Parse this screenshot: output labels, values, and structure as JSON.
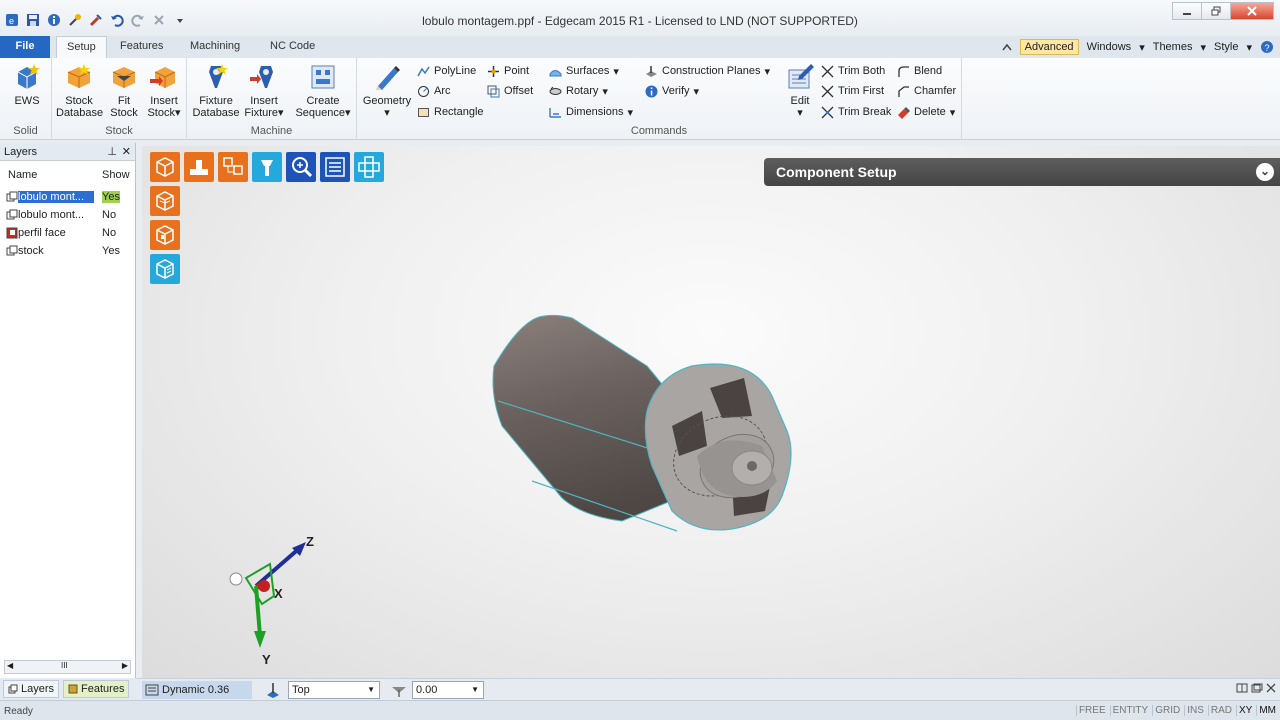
{
  "window": {
    "title": "lobulo montagem.ppf - Edgecam 2015 R1  -  Licensed to LND (NOT SUPPORTED)"
  },
  "tabs": {
    "file": "File",
    "items": [
      "Setup",
      "Features",
      "Machining",
      "NC Code"
    ],
    "active": "Setup"
  },
  "tab_right": {
    "advanced": "Advanced",
    "windows": "Windows",
    "themes": "Themes",
    "style": "Style"
  },
  "ribbon": {
    "solid": {
      "label": "Solid",
      "ews": "EWS"
    },
    "stock": {
      "label": "Stock",
      "stock_database": [
        "Stock",
        "Database"
      ],
      "fit_stock": [
        "Fit",
        "Stock"
      ],
      "insert_stock": [
        "Insert",
        "Stock"
      ]
    },
    "machine": {
      "label": "Machine",
      "fixture_database": [
        "Fixture",
        "Database"
      ],
      "insert_fixture": [
        "Insert",
        "Fixture"
      ],
      "create_sequence": [
        "Create",
        "Sequence"
      ]
    },
    "commands": {
      "label": "Commands",
      "geometry": "Geometry",
      "polyline": "PolyLine",
      "point": "Point",
      "arc": "Arc",
      "offset": "Offset",
      "rectangle": "Rectangle",
      "surfaces": "Surfaces",
      "rotary": "Rotary",
      "dimensions": "Dimensions",
      "construction_planes": "Construction Planes",
      "verify": "Verify",
      "edit": "Edit",
      "trim_both": "Trim Both",
      "trim_first": "Trim First",
      "trim_break": "Trim Break",
      "blend": "Blend",
      "chamfer": "Chamfer",
      "delete": "Delete"
    }
  },
  "layers": {
    "title": "Layers",
    "col_name": "Name",
    "col_show": "Show",
    "rows": [
      {
        "name": "lobulo mont...",
        "show": "Yes"
      },
      {
        "name": "lobulo mont...",
        "show": "No"
      },
      {
        "name": "perfil face",
        "show": "No"
      },
      {
        "name": "stock",
        "show": "Yes"
      }
    ],
    "scroll_glyph": "III"
  },
  "panel_tabs": {
    "layers": "Layers",
    "features": "Features"
  },
  "viewport": {
    "component_setup": "Component Setup",
    "axes": {
      "x": "X",
      "y": "Y",
      "z": "Z"
    }
  },
  "viewbar": {
    "dynamic": "Dynamic 0.36",
    "view": "Top",
    "angle": "0.00"
  },
  "status": {
    "text": "Ready",
    "flags": [
      "FREE",
      "ENTITY",
      "GRID",
      "INS",
      "RAD",
      "XY",
      "MM"
    ]
  },
  "colors": {
    "accent_orange": "#e8711d",
    "accent_cyan": "#25a8dc",
    "accent_blue": "#1e54b8",
    "file_tab": "#2468c4"
  }
}
